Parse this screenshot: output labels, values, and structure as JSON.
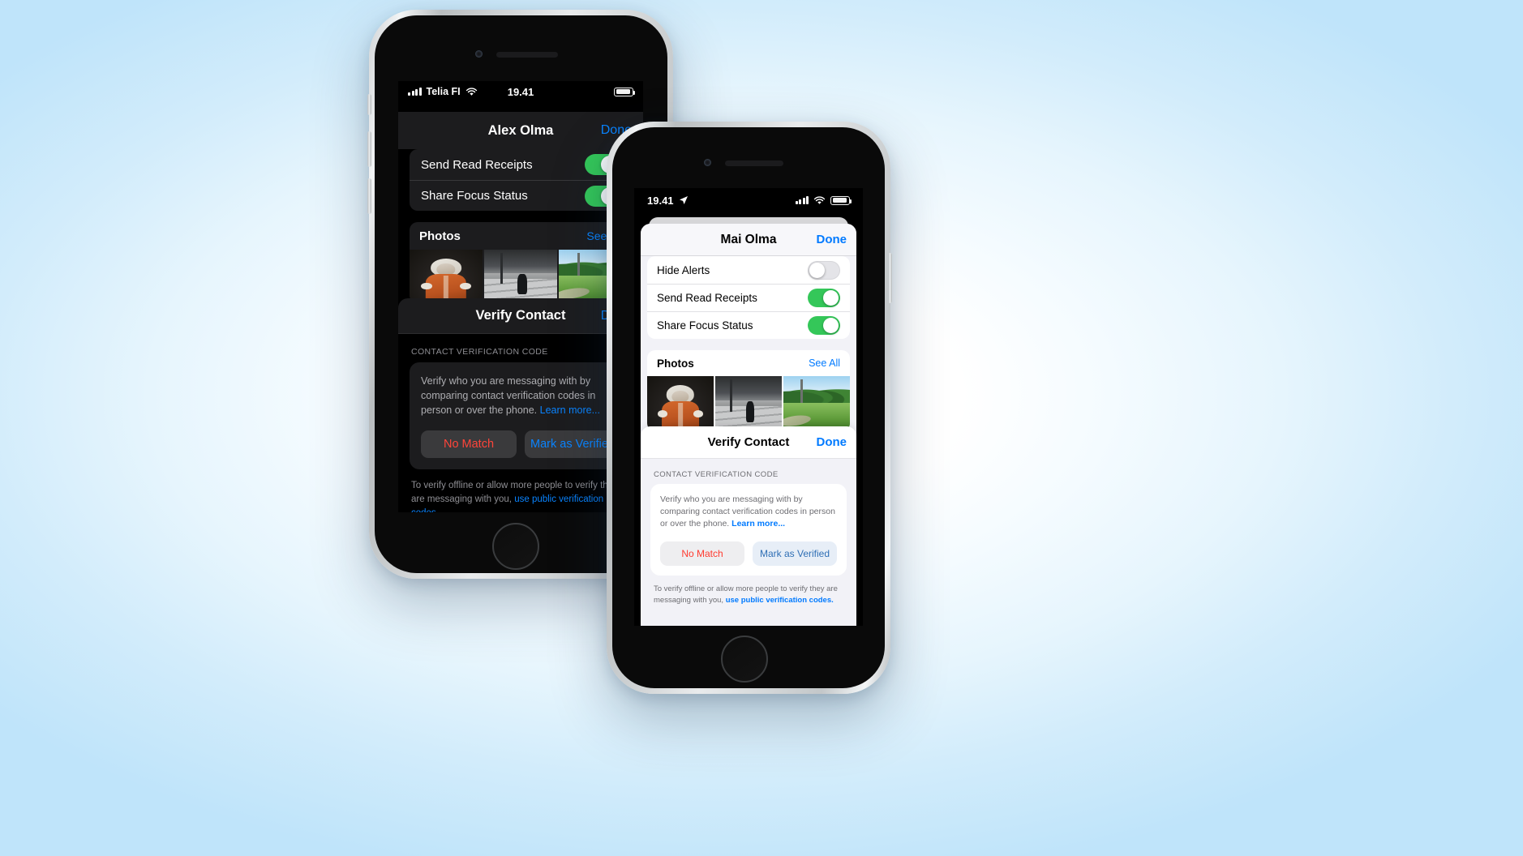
{
  "scene": {
    "background_color": "#e8f4fd",
    "accent_blue": "#0a84ff",
    "light_blue": "#007aff",
    "green_toggle": "#34c759",
    "red_destructive": "#ff453a",
    "red_destructive_light": "#ff3b30"
  },
  "back_phone": {
    "theme": "dark",
    "status_bar": {
      "carrier": "Telia FI",
      "time": "19.41",
      "signal_icon": "cellular-bars-icon",
      "wifi_icon": "wifi-icon",
      "battery_icon": "battery-icon"
    },
    "navbar": {
      "title": "Alex Olma",
      "done_label": "Done"
    },
    "settings_rows": [
      {
        "label": "Send Read Receipts",
        "toggle": "on"
      },
      {
        "label": "Share Focus Status",
        "toggle": "on"
      }
    ],
    "photos_section": {
      "title": "Photos",
      "see_all_label": "See All"
    },
    "sheet": {
      "title": "Verify Contact",
      "done_label": "Done",
      "section_header": "CONTACT VERIFICATION CODE",
      "description": "Verify who you are messaging with by comparing contact verification codes in person or over the phone.",
      "learn_more_label": "Learn more...",
      "no_match_label": "No Match",
      "mark_verified_label": "Mark as Verified",
      "footnote_prefix": "To verify offline or allow more people to verify they are messaging with you, ",
      "footnote_link": "use public verification codes.",
      "footnote_suffix": ""
    }
  },
  "front_phone": {
    "theme": "light",
    "status_bar": {
      "time": "19.41",
      "location_icon": "location-arrow-icon",
      "signal_icon": "cellular-bars-icon",
      "wifi_icon": "wifi-icon",
      "battery_icon": "battery-icon"
    },
    "navbar": {
      "title": "Mai Olma",
      "done_label": "Done"
    },
    "settings_rows": [
      {
        "label": "Hide Alerts",
        "toggle": "off"
      },
      {
        "label": "Send Read Receipts",
        "toggle": "on"
      },
      {
        "label": "Share Focus Status",
        "toggle": "on"
      }
    ],
    "photos_section": {
      "title": "Photos",
      "see_all_label": "See All"
    },
    "sheet": {
      "title": "Verify Contact",
      "done_label": "Done",
      "section_header": "CONTACT VERIFICATION CODE",
      "description": "Verify who you are messaging with by comparing contact verification codes in person or over the phone. ",
      "learn_more_label": "Learn more...",
      "no_match_label": "No Match",
      "mark_verified_label": "Mark as Verified",
      "footnote_prefix": "To verify offline or allow more people to verify they are messaging with you, ",
      "footnote_link": "use public verification codes.",
      "footnote_suffix": ""
    }
  }
}
